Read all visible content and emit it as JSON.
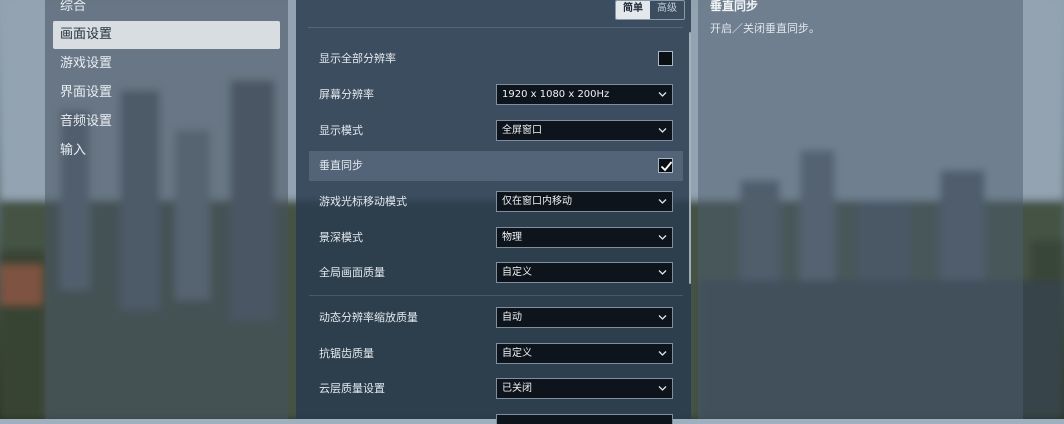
{
  "nav": {
    "items": [
      {
        "label": "综合",
        "active": false
      },
      {
        "label": "画面设置",
        "active": true
      },
      {
        "label": "游戏设置",
        "active": false
      },
      {
        "label": "界面设置",
        "active": false
      },
      {
        "label": "音频设置",
        "active": false
      },
      {
        "label": "输入",
        "active": false
      }
    ]
  },
  "mode_toggle": {
    "simple": "简单",
    "advanced": "高级",
    "selected": "简单"
  },
  "settings": [
    {
      "label": "显示全部分辨率",
      "kind": "checkbox",
      "checked": false
    },
    {
      "label": "屏幕分辨率",
      "kind": "select",
      "value": "1920 x 1080 x 200Hz"
    },
    {
      "label": "显示模式",
      "kind": "select",
      "value": "全屏窗口"
    },
    {
      "label": "垂直同步",
      "kind": "checkbox",
      "checked": true,
      "highlighted": true
    },
    {
      "label": "游戏光标移动模式",
      "kind": "select",
      "value": "仅在窗口内移动"
    },
    {
      "label": "景深模式",
      "kind": "select",
      "value": "物理"
    },
    {
      "label": "全局画面质量",
      "kind": "select",
      "value": "自定义"
    },
    {
      "label": "动态分辨率缩放质量",
      "kind": "select",
      "value": "自动"
    },
    {
      "label": "抗锯齿质量",
      "kind": "select",
      "value": "自定义"
    },
    {
      "label": "云层质量设置",
      "kind": "select",
      "value": "已关闭"
    }
  ],
  "info": {
    "title": "垂直同步",
    "description": "开启／关闭垂直同步。"
  },
  "colors": {
    "accent_active_bg": "#d8dde2",
    "panel_bg": "#283a4e",
    "select_bg": "#0d141b"
  }
}
